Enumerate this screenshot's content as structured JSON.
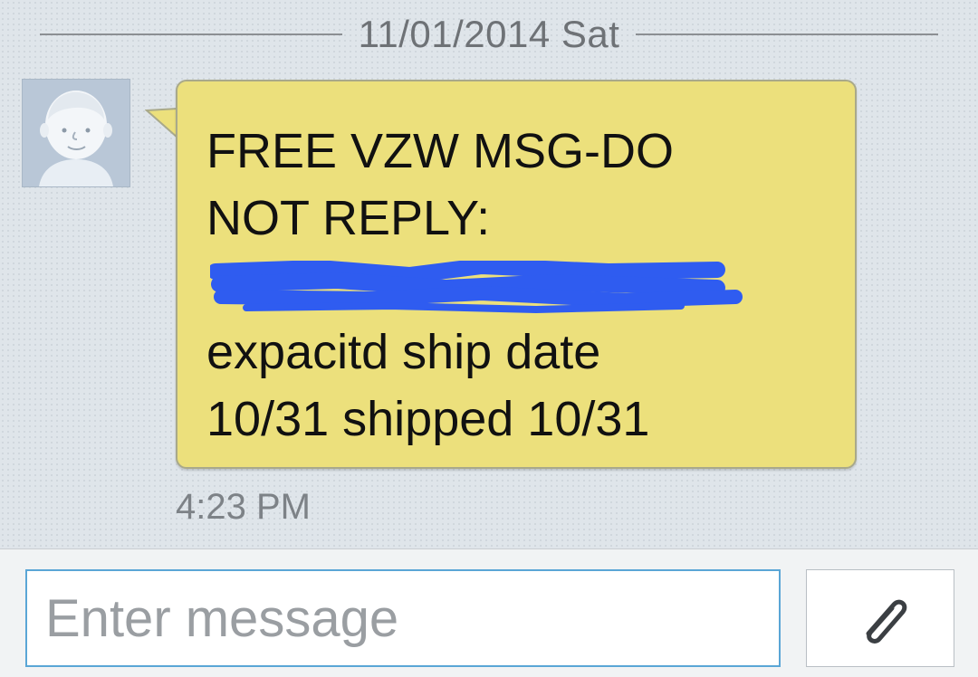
{
  "conversation": {
    "date_separator": "11/01/2014 Sat",
    "message": {
      "lines": [
        "FREE VZW MSG-DO",
        "NOT REPLY:",
        "expacitd ship date",
        "10/31 shipped 10/31"
      ],
      "redaction_color": "#2f5cf0",
      "time": "4:23 PM",
      "bubble_color": "#ece07c"
    },
    "avatar_icon": "default-contact-avatar"
  },
  "composer": {
    "placeholder": "Enter message",
    "value": "",
    "attach_icon": "paperclip-icon",
    "input_border_color": "#5aa6d6"
  }
}
